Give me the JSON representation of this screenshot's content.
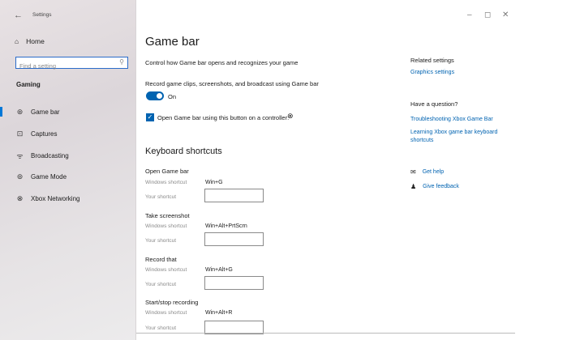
{
  "window": {
    "title": "Settings",
    "back_icon": "←",
    "minimize": "–",
    "maximize": "◻",
    "close": "✕"
  },
  "sidebar": {
    "home": {
      "icon": "⌂",
      "label": "Home"
    },
    "search_placeholder": "Find a setting",
    "search_icon": "⚲",
    "section": "Gaming",
    "items": [
      {
        "icon": "⊛",
        "label": "Game bar",
        "active": true
      },
      {
        "icon": "⊡",
        "label": "Captures"
      },
      {
        "icon": "ᯤ",
        "label": "Broadcasting"
      },
      {
        "icon": "⊚",
        "label": "Game Mode"
      },
      {
        "icon": "⊗",
        "label": "Xbox Networking"
      }
    ]
  },
  "main": {
    "title": "Game bar",
    "description": "Control how Game bar opens and recognizes your game",
    "record_label": "Record game clips, screenshots, and broadcast using Game bar",
    "toggle_state": "On",
    "checkbox_label": "Open Game bar using this button on a controller:",
    "checkbox_checked": true,
    "keyboard_header": "Keyboard shortcuts",
    "windows_shortcut_label": "Windows shortcut",
    "your_shortcut_label": "Your shortcut",
    "shortcuts": [
      {
        "title": "Open Game bar",
        "windows": "Win+G"
      },
      {
        "title": "Take screenshot",
        "windows": "Win+Alt+PrtScrn"
      },
      {
        "title": "Record that",
        "windows": "Win+Alt+G"
      },
      {
        "title": "Start/stop recording",
        "windows": "Win+Alt+R"
      }
    ]
  },
  "right": {
    "related_header": "Related settings",
    "graphics_link": "Graphics settings",
    "question_header": "Have a question?",
    "troubleshoot_link": "Troubleshooting Xbox Game Bar",
    "learning_link": "Learning Xbox game bar keyboard shortcuts",
    "get_help": "Get help",
    "give_feedback": "Give feedback"
  },
  "colors": {
    "accent": "#0063b1",
    "link": "#0063b1"
  }
}
